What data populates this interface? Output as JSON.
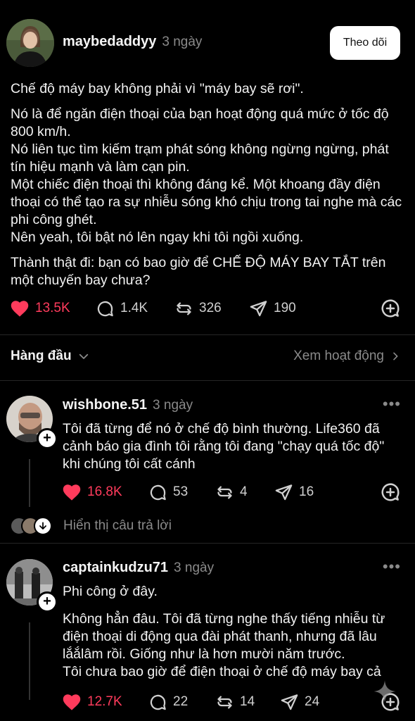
{
  "post": {
    "username": "maybedaddyy",
    "time": "3 ngày",
    "follow_label": "Theo dõi",
    "paragraphs": [
      "Chế độ máy bay không phải vì \"máy bay sẽ rơi\".",
      "Nó là để ngăn điện thoại của bạn hoạt động quá mức ở tốc độ 800 km/h.\nNó liên tục tìm kiếm trạm phát sóng không ngừng ngừng, phát tín hiệu mạnh và làm cạn pin.\nMột chiếc điện thoại thì không đáng kể. Một khoang đầy điện thoại có thể tạo ra sự nhiễu sóng khó chịu trong tai nghe mà các phi công ghét.\nNên yeah, tôi bật nó lên ngay khi tôi ngồi xuống.",
      "Thành thật đi: bạn có bao giờ để CHẾ ĐỘ MÁY BAY TẮT trên một chuyến bay chưa?"
    ],
    "likes": "13.5K",
    "comments": "1.4K",
    "reposts": "326",
    "shares": "190"
  },
  "sort": {
    "label": "Hàng đầu",
    "activity_link": "Xem hoạt động"
  },
  "replies": [
    {
      "username": "wishbone.51",
      "time": "3 ngày",
      "text": "Tôi đã từng để nó ở chế độ bình thường. Life360 đã cảnh báo gia đình tôi rằng tôi đang \"chạy quá tốc độ\" khi chúng tôi cất cánh",
      "likes": "16.8K",
      "comments": "53",
      "reposts": "4",
      "shares": "16",
      "show_replies": "Hiển thị câu trả lời"
    },
    {
      "username": "captainkudzu71",
      "time": "3 ngày",
      "paragraphs": [
        "Phi công ở đây.",
        "Không hẳn đâu. Tôi đã từng nghe thấy tiếng nhiễu từ điện thoại di động qua đài phát thanh, nhưng đã lâu lắắlâm rồi. Giống như là hơn mười năm trước.\nTôi chưa bao giờ để điện thoại ở chế độ máy bay cả"
      ],
      "likes": "12.7K",
      "comments": "22",
      "reposts": "14",
      "shares": "24"
    }
  ],
  "colors": {
    "like": "#ff3b5c",
    "background": "#000000",
    "muted": "#8a8a8a"
  }
}
